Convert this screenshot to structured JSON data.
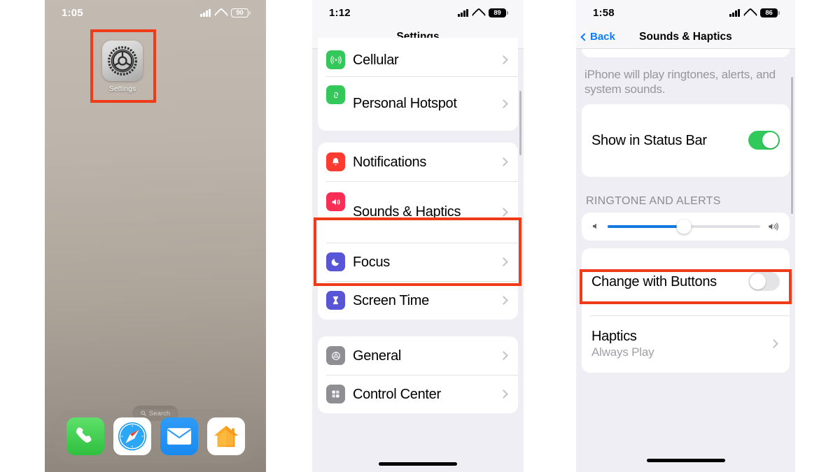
{
  "panels": {
    "home": {
      "status": {
        "time": "1:05",
        "battery": "90",
        "signal_icon": "cellular-signal-icon",
        "wifi_icon": "wifi-icon"
      },
      "app": {
        "label": "Settings",
        "icon": "settings-gear-icon"
      },
      "search": {
        "label": "Search",
        "icon": "search-icon"
      },
      "dock": [
        {
          "name": "Phone",
          "icon": "phone-icon"
        },
        {
          "name": "Safari",
          "icon": "safari-compass-icon"
        },
        {
          "name": "Mail",
          "icon": "mail-envelope-icon"
        },
        {
          "name": "Home",
          "icon": "home-house-icon"
        }
      ]
    },
    "settings": {
      "status": {
        "time": "1:12",
        "battery": "89"
      },
      "title": "Settings",
      "groups": [
        {
          "rows": [
            {
              "label": "Cellular",
              "icon": "cellular-antenna-icon",
              "color": "#34c759"
            },
            {
              "label": "Personal Hotspot",
              "icon": "hotspot-link-icon",
              "color": "#34c759"
            }
          ]
        },
        {
          "rows": [
            {
              "label": "Notifications",
              "icon": "notifications-bell-icon",
              "color": "#ff3b30"
            },
            {
              "label": "Sounds & Haptics",
              "icon": "sounds-speaker-icon",
              "color": "#fa2d55"
            },
            {
              "label": "Focus",
              "icon": "focus-moon-icon",
              "color": "#5856d6"
            },
            {
              "label": "Screen Time",
              "icon": "screen-time-hourglass-icon",
              "color": "#5856d6"
            }
          ]
        },
        {
          "rows": [
            {
              "label": "General",
              "icon": "general-gear-icon",
              "color": "#8e8e93"
            },
            {
              "label": "Control Center",
              "icon": "control-center-icon",
              "color": "#8e8e93"
            }
          ]
        }
      ]
    },
    "sounds": {
      "status": {
        "time": "1:58",
        "battery": "86"
      },
      "back_label": "Back",
      "title": "Sounds & Haptics",
      "footnote": "iPhone will play ringtones, alerts, and system sounds.",
      "show_in_status_bar": {
        "label": "Show in Status Bar",
        "state": "on"
      },
      "section_header": "RINGTONE AND ALERTS",
      "slider": {
        "value": 50,
        "min_icon": "speaker-low-icon",
        "max_icon": "speaker-high-icon"
      },
      "change_with_buttons": {
        "label": "Change with Buttons",
        "state": "off"
      },
      "haptics": {
        "label": "Haptics",
        "value": "Always Play"
      }
    }
  },
  "highlights": {
    "color": "#ef3b18",
    "targets": [
      "settings-app-icon",
      "sounds-and-haptics-row",
      "ringtone-volume-slider"
    ]
  }
}
